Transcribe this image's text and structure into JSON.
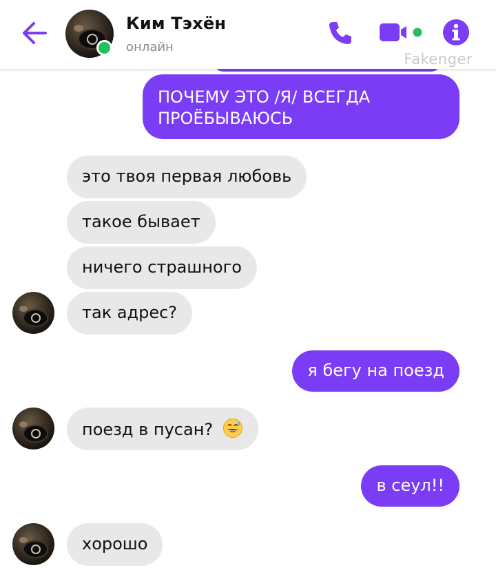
{
  "header": {
    "contact_name": "Ким Тэхён",
    "status": "онлайн",
    "watermark": "Fakenger",
    "back_icon": "arrow-left-icon",
    "call_icon": "phone-icon",
    "video_icon": "video-camera-icon",
    "info_icon": "info-icon",
    "online_dot_color": "#21c25e"
  },
  "colors": {
    "accent": "#7a3cf5",
    "incoming_bubble": "#e8e8e8",
    "outgoing_text": "#ffffff",
    "incoming_text": "#111111"
  },
  "messages": [
    {
      "from": "me",
      "lines": [
        "ПОЧЕМУ ЭТО /Я/ ВСЕГДА",
        "ПРОЁБЫВАЮСЬ"
      ]
    },
    {
      "from": "contact",
      "text": "это твоя первая любовь"
    },
    {
      "from": "contact",
      "text": "такое бывает"
    },
    {
      "from": "contact",
      "text": "ничего страшного"
    },
    {
      "from": "contact",
      "text": "так адрес?"
    },
    {
      "from": "me",
      "text": "я бегу на поезд"
    },
    {
      "from": "contact",
      "text": "поезд в пусан?",
      "emoji": "grinning-sweat-emoji"
    },
    {
      "from": "me",
      "text": "в сеул!!"
    },
    {
      "from": "contact",
      "text": "хорошо"
    }
  ]
}
